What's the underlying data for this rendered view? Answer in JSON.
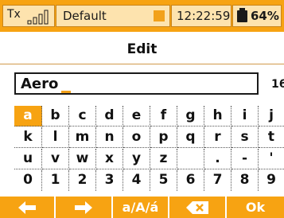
{
  "status_bar": {
    "tx_label": "Tx",
    "model_name": "Default",
    "time": "12:22:59",
    "battery_percent": "64%"
  },
  "title": "Edit",
  "text_field": {
    "value": "Aero",
    "remaining_chars": "16"
  },
  "keyboard": {
    "rows": [
      [
        "a",
        "b",
        "c",
        "d",
        "e",
        "f",
        "g",
        "h",
        "i",
        "j"
      ],
      [
        "k",
        "l",
        "m",
        "n",
        "o",
        "p",
        "q",
        "r",
        "s",
        "t"
      ],
      [
        "u",
        "v",
        "w",
        "x",
        "y",
        "z",
        "",
        ".",
        "-",
        "'"
      ],
      [
        "0",
        "1",
        "2",
        "3",
        "4",
        "5",
        "6",
        "7",
        "8",
        "9"
      ]
    ],
    "selected_key": "a"
  },
  "bottom_bar": {
    "left_icon": "arrow-left-icon",
    "right_icon": "arrow-right-icon",
    "case_label": "a/A/á",
    "backspace_icon": "backspace-icon",
    "ok_label": "Ok"
  },
  "colors": {
    "accent": "#f7a312",
    "accent_light": "#fde3ae"
  }
}
